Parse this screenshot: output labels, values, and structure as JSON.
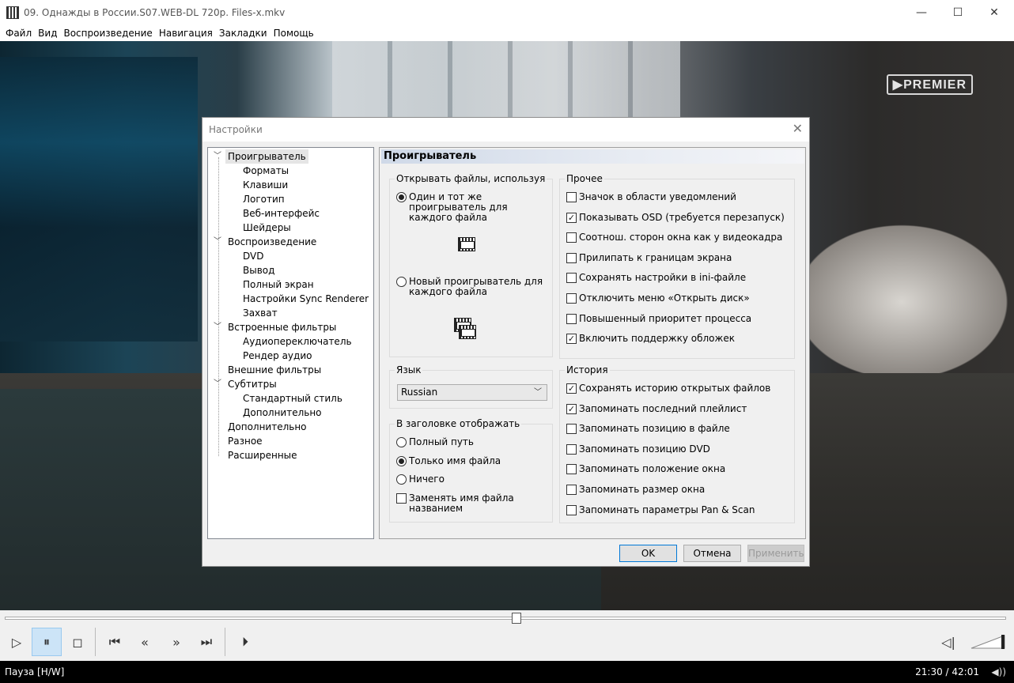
{
  "window": {
    "title": "09. Однажды в России.S07.WEB-DL 720p. Files-x.mkv",
    "minimize": "—",
    "maximize": "☐",
    "close": "✕"
  },
  "menu": [
    "Файл",
    "Вид",
    "Воспроизведение",
    "Навигация",
    "Закладки",
    "Помощь"
  ],
  "video": {
    "watermark": "▶PREMIER"
  },
  "dialog": {
    "title": "Настройки",
    "close": "✕",
    "tree": [
      {
        "label": "Проигрыватель",
        "level": 0,
        "expanded": true,
        "selected": true
      },
      {
        "label": "Форматы",
        "level": 1
      },
      {
        "label": "Клавиши",
        "level": 1
      },
      {
        "label": "Логотип",
        "level": 1
      },
      {
        "label": "Веб-интерфейс",
        "level": 1
      },
      {
        "label": "Шейдеры",
        "level": 1
      },
      {
        "label": "Воспроизведение",
        "level": 0,
        "expanded": true
      },
      {
        "label": "DVD",
        "level": 1
      },
      {
        "label": "Вывод",
        "level": 1
      },
      {
        "label": "Полный экран",
        "level": 1
      },
      {
        "label": "Настройки Sync Renderer",
        "level": 1
      },
      {
        "label": "Захват",
        "level": 1
      },
      {
        "label": "Встроенные фильтры",
        "level": 0,
        "expanded": true
      },
      {
        "label": "Аудиопереключатель",
        "level": 1
      },
      {
        "label": "Рендер аудио",
        "level": 1
      },
      {
        "label": "Внешние фильтры",
        "level": 0
      },
      {
        "label": "Субтитры",
        "level": 0,
        "expanded": true
      },
      {
        "label": "Стандартный стиль",
        "level": 1
      },
      {
        "label": "Дополнительно",
        "level": 1
      },
      {
        "label": "Дополнительно",
        "level": 0
      },
      {
        "label": "Разное",
        "level": 0
      },
      {
        "label": "Расширенные",
        "level": 0
      }
    ],
    "page_title": "Проигрыватель",
    "open_files": {
      "label": "Открывать файлы, используя",
      "same_player": "Один и тот же проигрыватель для каждого файла",
      "new_player": "Новый проигрыватель для каждого файла",
      "selected": "same_player"
    },
    "other": {
      "label": "Прочее",
      "items": [
        {
          "label": "Значок в области уведомлений",
          "checked": false
        },
        {
          "label": "Показывать OSD (требуется перезапуск)",
          "checked": true
        },
        {
          "label": "Соотнош. сторон окна как у видеокадра",
          "checked": false
        },
        {
          "label": "Прилипать к границам экрана",
          "checked": false
        },
        {
          "label": "Сохранять настройки в ini-файле",
          "checked": false
        },
        {
          "label": "Отключить меню «Открыть диск»",
          "checked": false
        },
        {
          "label": "Повышенный приоритет процесса",
          "checked": false
        },
        {
          "label": "Включить поддержку обложек",
          "checked": true
        }
      ]
    },
    "language": {
      "label": "Язык",
      "value": "Russian"
    },
    "title_display": {
      "label": "В заголовке отображать",
      "full_path": "Полный путь",
      "file_name": "Только имя файла",
      "nothing": "Ничего",
      "selected": "file_name",
      "replace_label": "Заменять имя файла названием",
      "replace_checked": false
    },
    "history": {
      "label": "История",
      "items": [
        {
          "label": "Сохранять историю открытых файлов",
          "checked": true
        },
        {
          "label": "Запоминать последний плейлист",
          "checked": true
        },
        {
          "label": "Запоминать позицию в файле",
          "checked": false
        },
        {
          "label": "Запоминать позицию DVD",
          "checked": false
        },
        {
          "label": "Запоминать положение окна",
          "checked": false
        },
        {
          "label": "Запоминать размер окна",
          "checked": false
        },
        {
          "label": "Запоминать параметры Pan & Scan",
          "checked": false
        }
      ]
    },
    "buttons": {
      "ok": "OK",
      "cancel": "Отмена",
      "apply": "Применить"
    }
  },
  "controls": {
    "play": "▷",
    "pause": "⏸",
    "stop": "◻",
    "prev": "⏮",
    "rewind": "«",
    "forward": "»",
    "next": "⏭",
    "frame_step": "⏵",
    "audio_icon": "◁|"
  },
  "seek": {
    "position": 0.511
  },
  "status": {
    "left": "Пауза [H/W]",
    "time": "21:30 / 42:01",
    "icon": "◀))"
  }
}
